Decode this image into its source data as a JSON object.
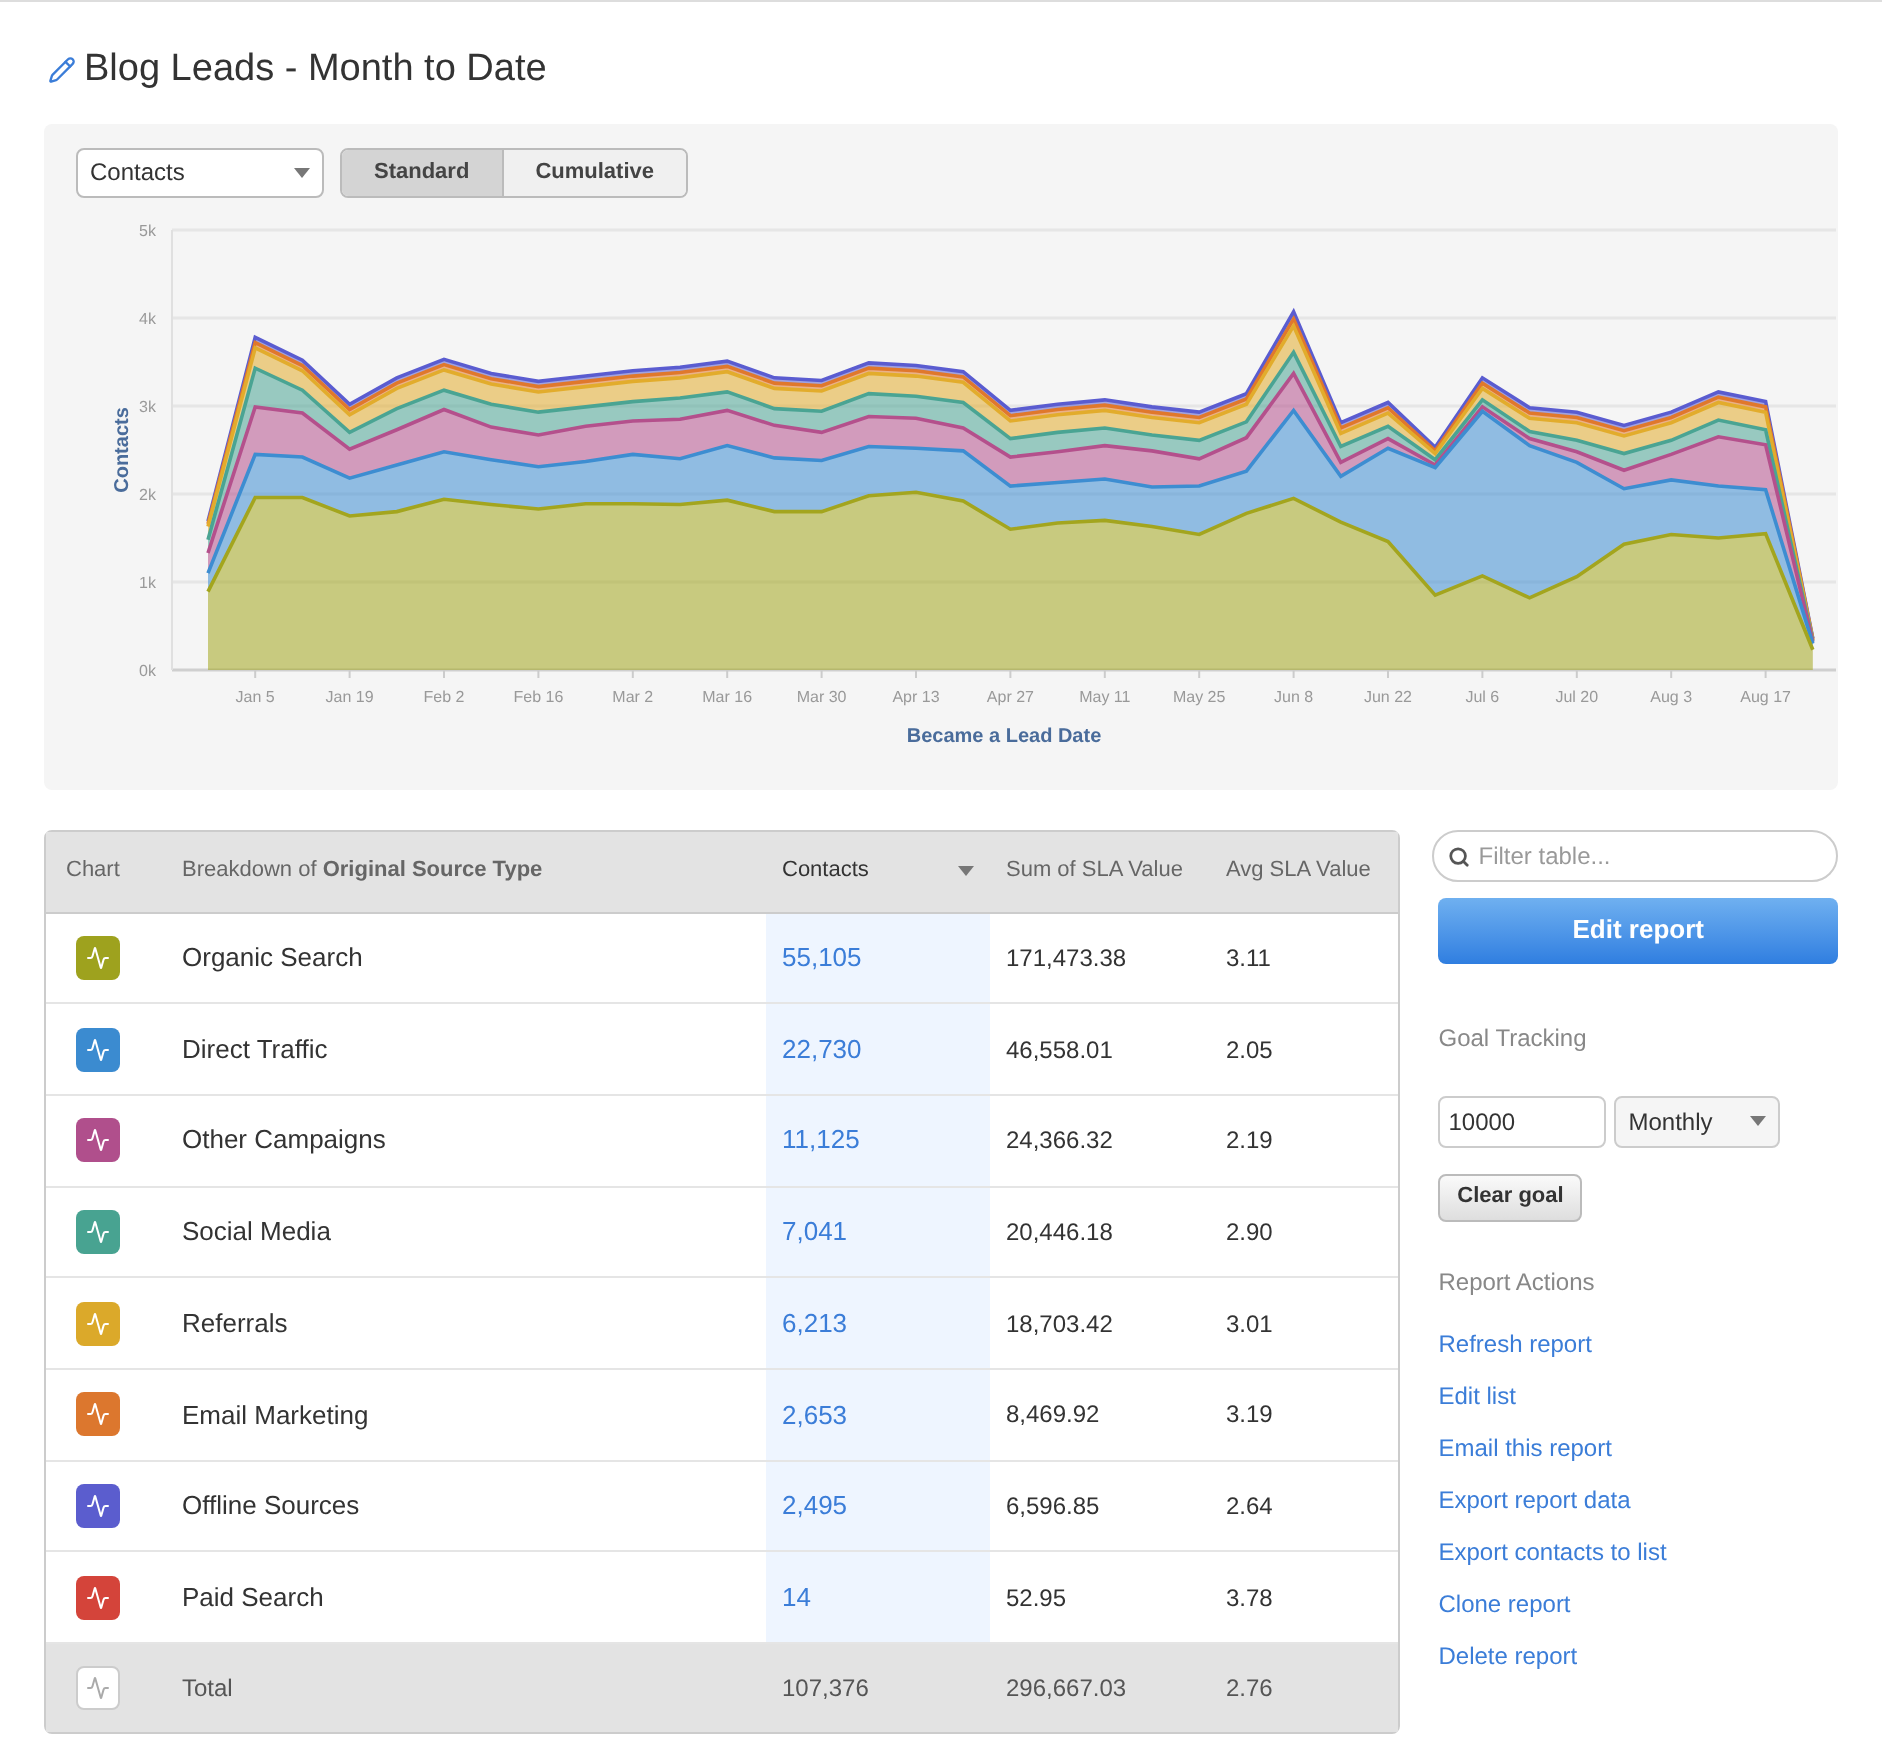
{
  "title": "Blog Leads - Month to Date",
  "chart_panel": {
    "metric_select": {
      "value": "Contacts"
    },
    "view_toggle": [
      {
        "label": "Standard",
        "selected": true
      },
      {
        "label": "Cumulative",
        "selected": false
      }
    ],
    "chart_data": {
      "type": "area",
      "stacked": true,
      "xlabel": "Became a Lead Date",
      "ylabel": "Contacts",
      "categories": [
        null,
        "Jan 5",
        null,
        "Jan 19",
        null,
        "Feb 2",
        null,
        "Feb 16",
        null,
        "Mar 2",
        null,
        "Mar 16",
        null,
        "Mar 30",
        null,
        "Apr 13",
        null,
        "Apr 27",
        null,
        "May 11",
        null,
        "May 25",
        null,
        "Jun 8",
        null,
        "Jun 22",
        null,
        "Jul 6",
        null,
        "Jul 20",
        null,
        "Aug 3",
        null,
        "Aug 17",
        null
      ],
      "ylim": [
        0,
        5000
      ],
      "grid": true,
      "yticks": [
        {
          "value": 0,
          "label": "0k"
        },
        {
          "value": 1000,
          "label": "1k"
        },
        {
          "value": 2000,
          "label": "2k"
        },
        {
          "value": 3000,
          "label": "3k"
        },
        {
          "value": 4000,
          "label": "4k"
        },
        {
          "value": 5000,
          "label": "5k"
        }
      ],
      "series": [
        {
          "color": "#a3a51e",
          "values": [
            890,
            1960,
            1960,
            1750,
            1800,
            1940,
            1880,
            1830,
            1890,
            1890,
            1880,
            1930,
            1800,
            1800,
            1980,
            2020,
            1920,
            1600,
            1670,
            1700,
            1630,
            1540,
            1780,
            1950,
            1680,
            1460,
            850,
            1070,
            820,
            1060,
            1430,
            1540,
            1500,
            1550,
            230
          ]
        },
        {
          "color": "#3d8dd1",
          "values": [
            210,
            490,
            460,
            430,
            530,
            540,
            510,
            480,
            480,
            560,
            520,
            620,
            610,
            580,
            560,
            500,
            570,
            490,
            460,
            470,
            450,
            550,
            480,
            1000,
            520,
            1060,
            1450,
            1870,
            1730,
            1300,
            630,
            620,
            590,
            500,
            70
          ]
        },
        {
          "color": "#b4508c",
          "values": [
            230,
            540,
            500,
            330,
            400,
            480,
            370,
            360,
            400,
            380,
            450,
            400,
            370,
            320,
            340,
            340,
            260,
            330,
            350,
            380,
            410,
            310,
            380,
            420,
            160,
            110,
            30,
            50,
            80,
            120,
            210,
            290,
            560,
            510,
            20
          ]
        },
        {
          "color": "#4aa493",
          "values": [
            150,
            440,
            260,
            190,
            240,
            220,
            260,
            260,
            220,
            220,
            240,
            210,
            190,
            240,
            260,
            250,
            290,
            210,
            220,
            200,
            180,
            210,
            180,
            240,
            180,
            140,
            60,
            80,
            80,
            130,
            190,
            160,
            190,
            170,
            10
          ]
        },
        {
          "color": "#e2ac2c",
          "values": [
            150,
            230,
            220,
            200,
            230,
            230,
            230,
            230,
            230,
            230,
            230,
            230,
            230,
            230,
            230,
            230,
            230,
            200,
            200,
            200,
            200,
            200,
            200,
            300,
            150,
            150,
            70,
            130,
            150,
            200,
            200,
            200,
            200,
            200,
            10
          ]
        },
        {
          "color": "#e0782c",
          "values": [
            30,
            60,
            60,
            60,
            60,
            60,
            60,
            60,
            60,
            60,
            60,
            60,
            60,
            60,
            60,
            60,
            60,
            60,
            60,
            60,
            60,
            60,
            60,
            80,
            60,
            60,
            30,
            60,
            60,
            60,
            60,
            60,
            60,
            60,
            10
          ]
        },
        {
          "color": "#5a5cd0",
          "values": [
            30,
            60,
            60,
            60,
            60,
            60,
            60,
            60,
            60,
            60,
            60,
            60,
            60,
            60,
            60,
            60,
            60,
            60,
            60,
            60,
            60,
            60,
            60,
            80,
            60,
            60,
            40,
            60,
            60,
            60,
            60,
            60,
            60,
            60,
            10
          ]
        }
      ]
    }
  },
  "table": {
    "columns": [
      {
        "label": "Chart",
        "sorted": false
      },
      {
        "label": "Breakdown of **Original Source Type**",
        "sorted": false
      },
      {
        "label": "Contacts",
        "sorted": true
      },
      {
        "label": "Sum of SLA Value",
        "sorted": false
      },
      {
        "label": "Avg SLA Value",
        "sorted": false
      }
    ],
    "rows": [
      {
        "source": "Organic Search",
        "color": "#9ea21e",
        "contacts": "55,105",
        "sum_sla": "171,473.38",
        "avg_sla": "3.11"
      },
      {
        "source": "Direct Traffic",
        "color": "#3b8bd0",
        "contacts": "22,730",
        "sum_sla": "46,558.01",
        "avg_sla": "2.05"
      },
      {
        "source": "Other Campaigns",
        "color": "#b04f8c",
        "contacts": "11,125",
        "sum_sla": "24,366.32",
        "avg_sla": "2.19"
      },
      {
        "source": "Social Media",
        "color": "#48a391",
        "contacts": "7,041",
        "sum_sla": "20,446.18",
        "avg_sla": "2.90"
      },
      {
        "source": "Referrals",
        "color": "#dba92a",
        "contacts": "6,213",
        "sum_sla": "18,703.42",
        "avg_sla": "3.01"
      },
      {
        "source": "Email Marketing",
        "color": "#dc772e",
        "contacts": "2,653",
        "sum_sla": "8,469.92",
        "avg_sla": "3.19"
      },
      {
        "source": "Offline Sources",
        "color": "#5b5dce",
        "contacts": "2,495",
        "sum_sla": "6,596.85",
        "avg_sla": "2.64"
      },
      {
        "source": "Paid Search",
        "color": "#d4443a",
        "contacts": "14",
        "sum_sla": "52.95",
        "avg_sla": "3.78"
      }
    ],
    "total": {
      "source": "Total",
      "contacts": "107,376",
      "sum_sla": "296,667.03",
      "avg_sla": "2.76"
    }
  },
  "sidebar": {
    "filter": {
      "placeholder": "Filter table..."
    },
    "edit_button": "Edit report",
    "goal_tracking": {
      "heading": "Goal Tracking",
      "goal_value": "10000",
      "period": "Monthly",
      "clear_button": "Clear goal"
    },
    "report_actions": {
      "heading": "Report Actions",
      "links": [
        "Refresh report",
        "Edit list",
        "Email this report",
        "Export report data",
        "Export contacts to list",
        "Clone report",
        "Delete report"
      ]
    }
  }
}
